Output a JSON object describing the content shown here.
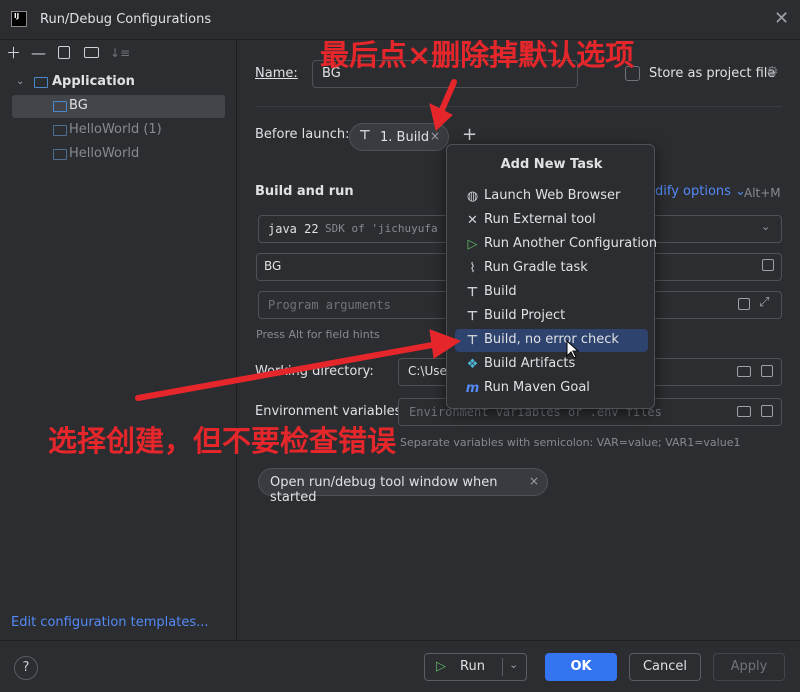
{
  "window": {
    "title": "Run/Debug Configurations",
    "app_icon_text": "IJ"
  },
  "sidebar": {
    "group_label": "Application",
    "items": [
      {
        "label": "BG",
        "selected": true
      },
      {
        "label": "HelloWorld (1)",
        "selected": false
      },
      {
        "label": "HelloWorld",
        "selected": false
      }
    ],
    "edit_templates_link": "Edit configuration templates..."
  },
  "form": {
    "name_label": "Name:",
    "name_value": "BG",
    "store_label": "Store as project file",
    "before_launch_label": "Before launch:",
    "build_chip_label": "1. Build",
    "section_title": "Build and run",
    "modify_options_label": "dify options",
    "modify_options_shortcut": "Alt+M",
    "sdk_prefix": "java 22",
    "sdk_suffix": "SDK of 'jichuyufa",
    "main_class_value": "BG",
    "program_args_placeholder": "Program arguments",
    "field_hints": "Press Alt for field hints",
    "working_dir_label": "Working directory:",
    "working_dir_value": "C:\\Use",
    "env_vars_label": "Environment variables:",
    "env_vars_placeholder": "Environment variables or .env files",
    "env_vars_hint": "Separate variables with semicolon: VAR=value; VAR1=value1",
    "open_tool_window_chip": "Open run/debug tool window when started"
  },
  "popup": {
    "title": "Add New Task",
    "items": [
      {
        "label": "Launch Web Browser",
        "icon": "globe-icon",
        "selected": false
      },
      {
        "label": "Run External tool",
        "icon": "tools-icon",
        "selected": false
      },
      {
        "label": "Run Another Configuration",
        "icon": "play-icon",
        "selected": false
      },
      {
        "label": "Run Gradle task",
        "icon": "gradle-icon",
        "selected": false
      },
      {
        "label": "Build",
        "icon": "hammer-icon",
        "selected": false
      },
      {
        "label": "Build Project",
        "icon": "hammer-icon",
        "selected": false
      },
      {
        "label": "Build, no error check",
        "icon": "hammer-icon",
        "selected": true
      },
      {
        "label": "Build Artifacts",
        "icon": "artifacts-icon",
        "selected": false
      },
      {
        "label": "Run Maven Goal",
        "icon": "maven-icon",
        "selected": false
      }
    ]
  },
  "footer": {
    "help_label": "?",
    "run_label": "Run",
    "ok_label": "OK",
    "cancel_label": "Cancel",
    "apply_label": "Apply"
  },
  "annotations": {
    "top_text": "最后点×删除掉默认选项",
    "bottom_text": "选择创建，但不要检查错误",
    "color": "#e5262b"
  },
  "colors": {
    "accent": "#3574f0",
    "selection": "#2e436e",
    "background": "#2b2d30"
  }
}
